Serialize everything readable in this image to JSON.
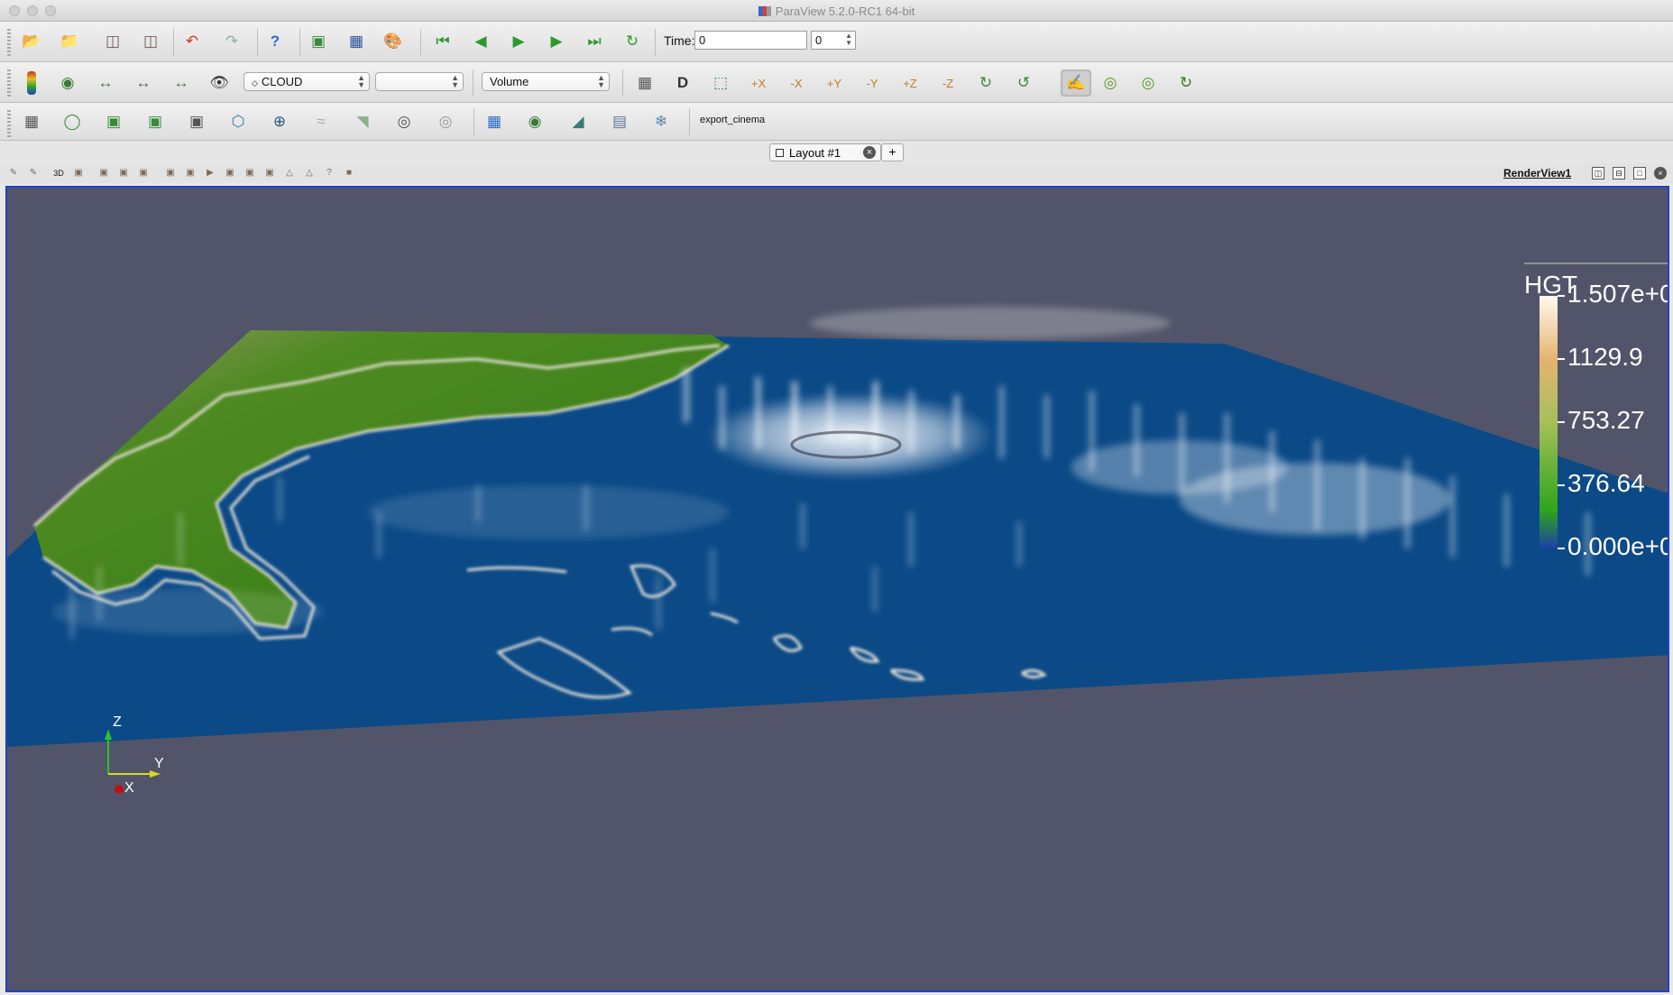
{
  "window": {
    "title": "ParaView 5.2.0-RC1 64-bit"
  },
  "toolbar_main": {
    "time_label": "Time:",
    "time_value": "0",
    "timestep_value": "0",
    "icons": [
      "open-icon",
      "recent-icon",
      "connect-icon",
      "disconnect-icon",
      "undo-icon",
      "redo-icon",
      "help-icon",
      "save-state-icon",
      "save-screenshot-icon",
      "palette-icon",
      "first-frame-icon",
      "previous-frame-icon",
      "play-icon",
      "next-frame-icon",
      "last-frame-icon",
      "loop-icon"
    ]
  },
  "toolbar_display": {
    "color_by_value": "CLOUD",
    "component_value": "",
    "representation_value": "Volume"
  },
  "toolbar_filters": {
    "macro_label": "export_cinema"
  },
  "layout": {
    "tab_label": "Layout #1",
    "add_tab_label": "+"
  },
  "view": {
    "name": "RenderView1",
    "mode_3d_label": "3D"
  },
  "color_legend": {
    "title": "HGT",
    "labels": [
      "1.507e+0",
      "1129.9",
      "753.27",
      "376.64",
      "0.000e+0"
    ],
    "colors": {
      "top": "#fffaf0",
      "upper": "#e6b370",
      "middle": "#8fbf4f",
      "lower": "#2ea51c",
      "bottom": "#1d3fa8"
    }
  },
  "orientation_axes": {
    "z_label": "Z",
    "y_label": "Y",
    "x_label": "X"
  },
  "scene_colors": {
    "background": "#525569",
    "ocean": "#0b4a87",
    "land": "#3e7d12",
    "coastline": "#e6e0d6",
    "cloud": "#ffffff"
  }
}
